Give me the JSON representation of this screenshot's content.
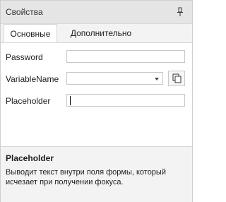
{
  "panel": {
    "title": "Свойства",
    "pin_icon": "pin-icon"
  },
  "tabs": [
    {
      "label": "Основные",
      "active": true
    },
    {
      "label": "Дополнительно",
      "active": false
    }
  ],
  "fields": {
    "password": {
      "label": "Password",
      "value": ""
    },
    "variable_name": {
      "label": "VariableName",
      "value": "",
      "button_icon": "copy-icon"
    },
    "placeholder": {
      "label": "Placeholder",
      "value": ""
    }
  },
  "help": {
    "title": "Placeholder",
    "text": "Выводит текст внутри поля формы, который исчезает при получении фокуса."
  }
}
